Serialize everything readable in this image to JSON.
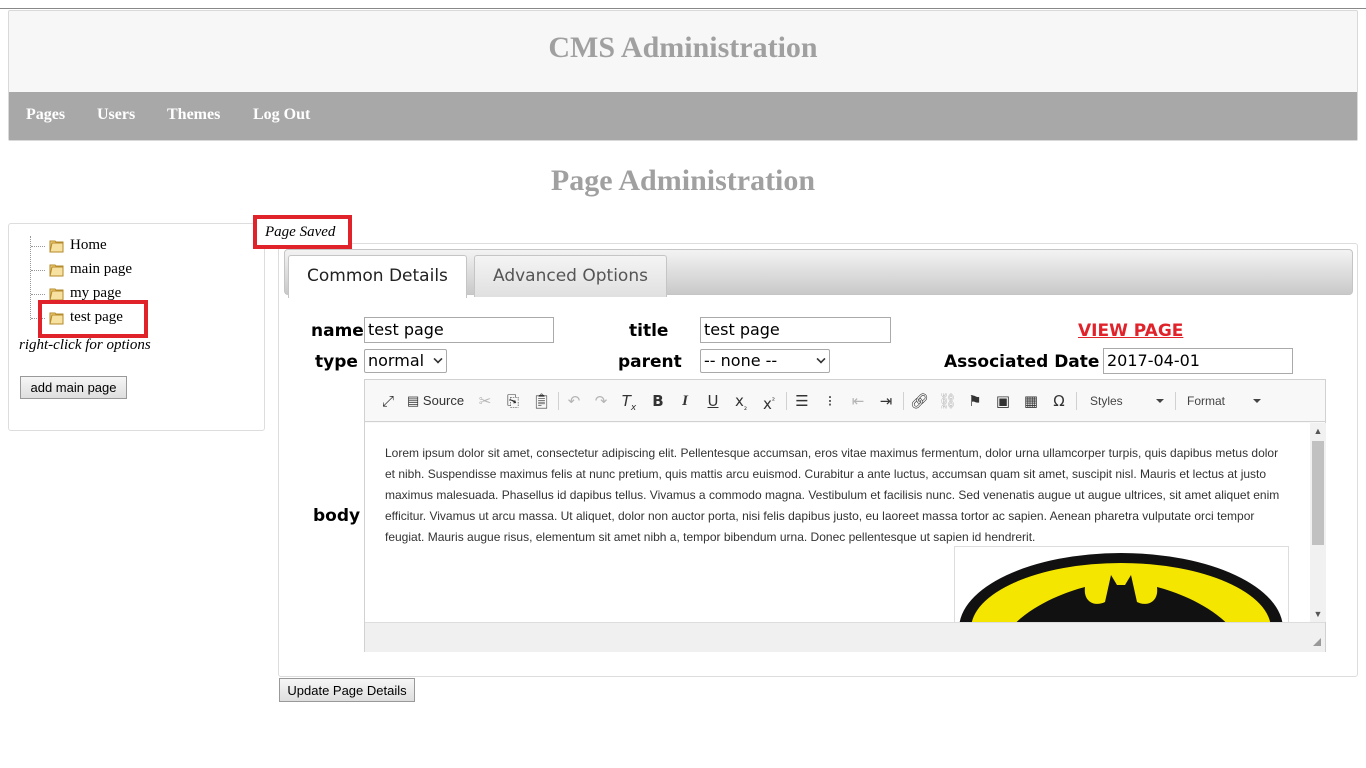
{
  "header": {
    "title": "CMS Administration"
  },
  "nav": [
    {
      "label": "Pages"
    },
    {
      "label": "Users"
    },
    {
      "label": "Themes"
    },
    {
      "label": "Log Out"
    }
  ],
  "page_title": "Page Administration",
  "sidebar": {
    "tree": [
      {
        "label": "Home",
        "icon": "folder-icon"
      },
      {
        "label": "main page",
        "icon": "folder-icon"
      },
      {
        "label": "my page",
        "icon": "folder-icon"
      },
      {
        "label": "test page",
        "icon": "folder-icon",
        "selected": true
      }
    ],
    "hint": "right-click for options",
    "add_button": "add main page"
  },
  "status_message": "Page Saved",
  "tabs": [
    {
      "label": "Common Details",
      "active": true
    },
    {
      "label": "Advanced Options",
      "active": false
    }
  ],
  "form": {
    "name_label": "name",
    "name_value": "test page",
    "title_label": "title",
    "title_value": "test page",
    "view_page": "VIEW PAGE",
    "type_label": "type",
    "type_value": "normal",
    "parent_label": "parent",
    "parent_value": "-- none --",
    "date_label": "Associated Date",
    "date_value": "2017-04-01",
    "body_label": "body"
  },
  "editor": {
    "toolbar": {
      "source": "Source",
      "styles": "Styles",
      "format": "Format"
    },
    "content": "Lorem ipsum dolor sit amet, consectetur adipiscing elit. Pellentesque accumsan, eros vitae maximus fermentum, dolor urna ullamcorper turpis, quis dapibus metus dolor et nibh. Suspendisse maximus felis at nunc pretium, quis mattis arcu euismod. Curabitur a ante luctus, accumsan quam sit amet, suscipit nisl. Mauris et lectus at justo maximus malesuada. Phasellus id dapibus tellus. Vivamus a commodo magna. Vestibulum et facilisis nunc. Sed venenatis augue ut augue ultrices, sit amet aliquet enim efficitur. Vivamus ut arcu massa. Ut aliquet, dolor non auctor porta, nisi felis dapibus justo, eu laoreet massa tortor ac sapien. Aenean pharetra vulputate orci tempor feugiat. Mauris augue risus, elementum sit amet nibh a, tempor bibendum urna. Donec pellentesque ut sapien id hendrerit."
  },
  "update_button": "Update Page Details",
  "colors": {
    "highlight": "#e0222a",
    "navbar": "#a8a8a8",
    "title_gray": "#a0a0a0"
  }
}
